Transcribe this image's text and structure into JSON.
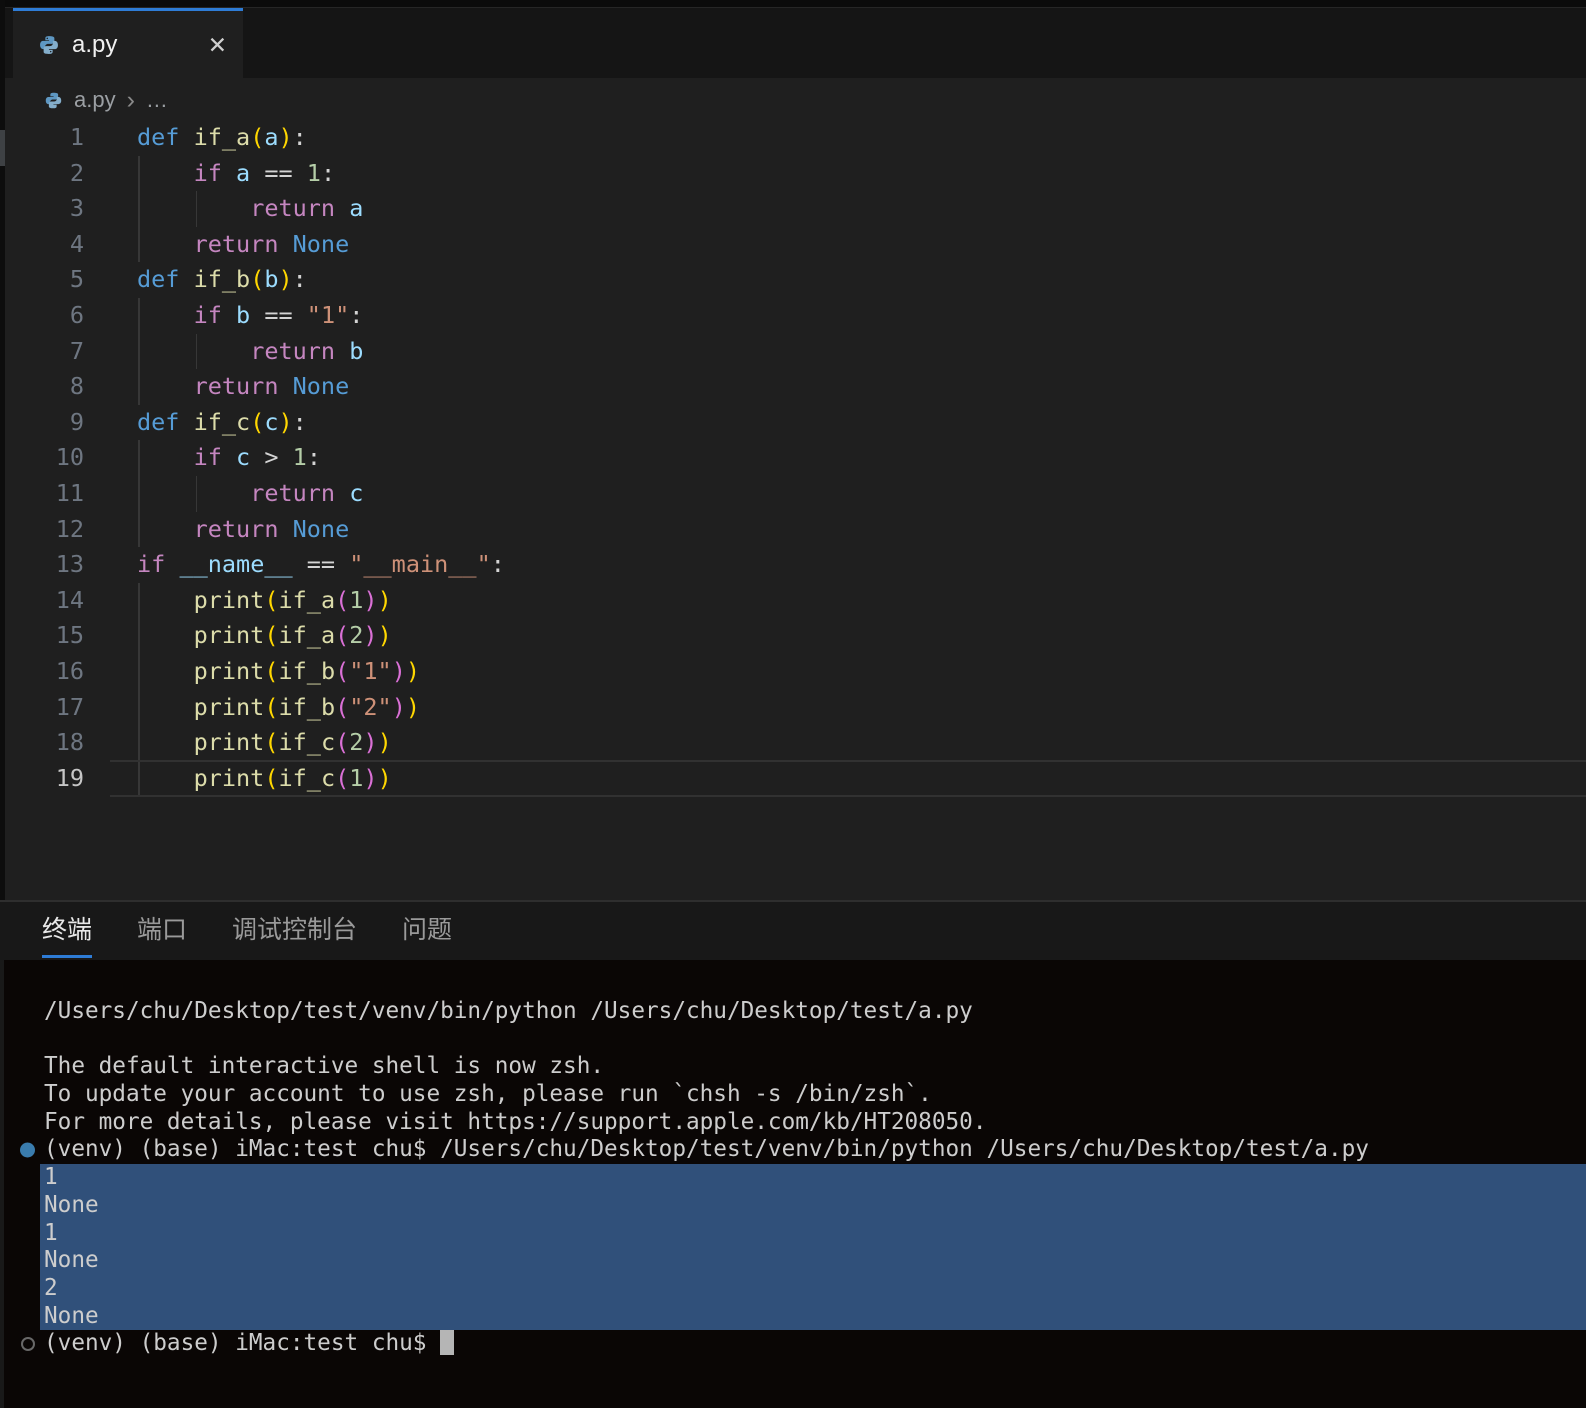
{
  "tab": {
    "title": "a.py"
  },
  "icons": {
    "close": "✕"
  },
  "breadcrumb": {
    "file": "a.py",
    "separator": "›",
    "ellipsis": "…"
  },
  "editor": {
    "active_line": 19,
    "lines": [
      {
        "n": 1,
        "ind": 0,
        "tokens": [
          {
            "t": "def",
            "c": "kw"
          },
          {
            "t": " "
          },
          {
            "t": "if_a",
            "c": "fn"
          },
          {
            "t": "(",
            "c": "b1"
          },
          {
            "t": "a",
            "c": "vr"
          },
          {
            "t": ")",
            "c": "b1"
          },
          {
            "t": ":"
          }
        ]
      },
      {
        "n": 2,
        "ind": 1,
        "tokens": [
          {
            "t": "    "
          },
          {
            "t": "if",
            "c": "ct"
          },
          {
            "t": " "
          },
          {
            "t": "a",
            "c": "vr"
          },
          {
            "t": " == "
          },
          {
            "t": "1",
            "c": "nm"
          },
          {
            "t": ":"
          }
        ]
      },
      {
        "n": 3,
        "ind": 2,
        "tokens": [
          {
            "t": "        "
          },
          {
            "t": "return",
            "c": "ct"
          },
          {
            "t": " "
          },
          {
            "t": "a",
            "c": "vr"
          }
        ]
      },
      {
        "n": 4,
        "ind": 1,
        "tokens": [
          {
            "t": "    "
          },
          {
            "t": "return",
            "c": "ct"
          },
          {
            "t": " "
          },
          {
            "t": "None",
            "c": "kw"
          }
        ]
      },
      {
        "n": 5,
        "ind": 0,
        "tokens": [
          {
            "t": "def",
            "c": "kw"
          },
          {
            "t": " "
          },
          {
            "t": "if_b",
            "c": "fn"
          },
          {
            "t": "(",
            "c": "b1"
          },
          {
            "t": "b",
            "c": "vr"
          },
          {
            "t": ")",
            "c": "b1"
          },
          {
            "t": ":"
          }
        ]
      },
      {
        "n": 6,
        "ind": 1,
        "tokens": [
          {
            "t": "    "
          },
          {
            "t": "if",
            "c": "ct"
          },
          {
            "t": " "
          },
          {
            "t": "b",
            "c": "vr"
          },
          {
            "t": " == "
          },
          {
            "t": "\"1\"",
            "c": "st"
          },
          {
            "t": ":"
          }
        ]
      },
      {
        "n": 7,
        "ind": 2,
        "tokens": [
          {
            "t": "        "
          },
          {
            "t": "return",
            "c": "ct"
          },
          {
            "t": " "
          },
          {
            "t": "b",
            "c": "vr"
          }
        ]
      },
      {
        "n": 8,
        "ind": 1,
        "tokens": [
          {
            "t": "    "
          },
          {
            "t": "return",
            "c": "ct"
          },
          {
            "t": " "
          },
          {
            "t": "None",
            "c": "kw"
          }
        ]
      },
      {
        "n": 9,
        "ind": 0,
        "tokens": [
          {
            "t": "def",
            "c": "kw"
          },
          {
            "t": " "
          },
          {
            "t": "if_c",
            "c": "fn"
          },
          {
            "t": "(",
            "c": "b1"
          },
          {
            "t": "c",
            "c": "vr"
          },
          {
            "t": ")",
            "c": "b1"
          },
          {
            "t": ":"
          }
        ]
      },
      {
        "n": 10,
        "ind": 1,
        "tokens": [
          {
            "t": "    "
          },
          {
            "t": "if",
            "c": "ct"
          },
          {
            "t": " "
          },
          {
            "t": "c",
            "c": "vr"
          },
          {
            "t": " > "
          },
          {
            "t": "1",
            "c": "nm"
          },
          {
            "t": ":"
          }
        ]
      },
      {
        "n": 11,
        "ind": 2,
        "tokens": [
          {
            "t": "        "
          },
          {
            "t": "return",
            "c": "ct"
          },
          {
            "t": " "
          },
          {
            "t": "c",
            "c": "vr"
          }
        ]
      },
      {
        "n": 12,
        "ind": 1,
        "tokens": [
          {
            "t": "    "
          },
          {
            "t": "return",
            "c": "ct"
          },
          {
            "t": " "
          },
          {
            "t": "None",
            "c": "kw"
          }
        ]
      },
      {
        "n": 13,
        "ind": 0,
        "tokens": [
          {
            "t": "if",
            "c": "ct"
          },
          {
            "t": " "
          },
          {
            "t": "__name__",
            "c": "vr"
          },
          {
            "t": " == "
          },
          {
            "t": "\"__main__\"",
            "c": "st"
          },
          {
            "t": ":"
          }
        ]
      },
      {
        "n": 14,
        "ind": 1,
        "tokens": [
          {
            "t": "    "
          },
          {
            "t": "print",
            "c": "fn"
          },
          {
            "t": "(",
            "c": "b1"
          },
          {
            "t": "if_a",
            "c": "fn"
          },
          {
            "t": "(",
            "c": "b2"
          },
          {
            "t": "1",
            "c": "nm"
          },
          {
            "t": ")",
            "c": "b2"
          },
          {
            "t": ")",
            "c": "b1"
          }
        ]
      },
      {
        "n": 15,
        "ind": 1,
        "tokens": [
          {
            "t": "    "
          },
          {
            "t": "print",
            "c": "fn"
          },
          {
            "t": "(",
            "c": "b1"
          },
          {
            "t": "if_a",
            "c": "fn"
          },
          {
            "t": "(",
            "c": "b2"
          },
          {
            "t": "2",
            "c": "nm"
          },
          {
            "t": ")",
            "c": "b2"
          },
          {
            "t": ")",
            "c": "b1"
          }
        ]
      },
      {
        "n": 16,
        "ind": 1,
        "tokens": [
          {
            "t": "    "
          },
          {
            "t": "print",
            "c": "fn"
          },
          {
            "t": "(",
            "c": "b1"
          },
          {
            "t": "if_b",
            "c": "fn"
          },
          {
            "t": "(",
            "c": "b2"
          },
          {
            "t": "\"1\"",
            "c": "st"
          },
          {
            "t": ")",
            "c": "b2"
          },
          {
            "t": ")",
            "c": "b1"
          }
        ]
      },
      {
        "n": 17,
        "ind": 1,
        "tokens": [
          {
            "t": "    "
          },
          {
            "t": "print",
            "c": "fn"
          },
          {
            "t": "(",
            "c": "b1"
          },
          {
            "t": "if_b",
            "c": "fn"
          },
          {
            "t": "(",
            "c": "b2"
          },
          {
            "t": "\"2\"",
            "c": "st"
          },
          {
            "t": ")",
            "c": "b2"
          },
          {
            "t": ")",
            "c": "b1"
          }
        ]
      },
      {
        "n": 18,
        "ind": 1,
        "tokens": [
          {
            "t": "    "
          },
          {
            "t": "print",
            "c": "fn"
          },
          {
            "t": "(",
            "c": "b1"
          },
          {
            "t": "if_c",
            "c": "fn"
          },
          {
            "t": "(",
            "c": "b2"
          },
          {
            "t": "2",
            "c": "nm"
          },
          {
            "t": ")",
            "c": "b2"
          },
          {
            "t": ")",
            "c": "b1"
          }
        ]
      },
      {
        "n": 19,
        "ind": 1,
        "tokens": [
          {
            "t": "    "
          },
          {
            "t": "print",
            "c": "fn"
          },
          {
            "t": "(",
            "c": "b1"
          },
          {
            "t": "if_c",
            "c": "fn"
          },
          {
            "t": "(",
            "c": "b2"
          },
          {
            "t": "1",
            "c": "nm"
          },
          {
            "t": ")",
            "c": "b2"
          },
          {
            "t": ")",
            "c": "b1"
          }
        ]
      }
    ]
  },
  "panel": {
    "tabs": [
      {
        "label": "终端",
        "active": true
      },
      {
        "label": "端口",
        "active": false
      },
      {
        "label": "调试控制台",
        "active": false
      },
      {
        "label": "问题",
        "active": false
      }
    ]
  },
  "terminal": {
    "rows": [
      {
        "text": "/Users/chu/Desktop/test/venv/bin/python /Users/chu/Desktop/test/a.py"
      },
      {
        "text": ""
      },
      {
        "text": "The default interactive shell is now zsh."
      },
      {
        "text": "To update your account to use zsh, please run `chsh -s /bin/zsh`."
      },
      {
        "text": "For more details, please visit https://support.apple.com/kb/HT208050."
      },
      {
        "text": "(venv) (base) iMac:test chu$ /Users/chu/Desktop/test/venv/bin/python /Users/chu/Desktop/test/a.py",
        "decoration": "filled"
      },
      {
        "text": "1",
        "selected": true
      },
      {
        "text": "None",
        "selected": true
      },
      {
        "text": "1",
        "selected": true
      },
      {
        "text": "None",
        "selected": true
      },
      {
        "text": "2",
        "selected": true
      },
      {
        "text": "None",
        "selected": true
      },
      {
        "text": "(venv) (base) iMac:test chu$ ",
        "decoration": "hollow",
        "cursor": true
      }
    ]
  },
  "colors": {
    "accent_blue": "#2e7cd6",
    "selection_blue": "#30507a",
    "decoration_blue": "#3a7cae",
    "editor_bg": "#1f1f1f",
    "tabbar_bg": "#151515",
    "terminal_bg": "#0a0605",
    "terminal_fg": "#cdcdcd",
    "line_number": "#6e7681",
    "line_number_active": "#c6c6c6",
    "tokens": {
      "fg": "#d4d4d4",
      "kw": "#569cd6",
      "ct": "#c586c0",
      "fn": "#dcdcaa",
      "vr": "#9cdcfe",
      "nm": "#b5cea8",
      "st": "#ce9178",
      "b1": "#ffd700",
      "b2": "#da70d6"
    }
  }
}
